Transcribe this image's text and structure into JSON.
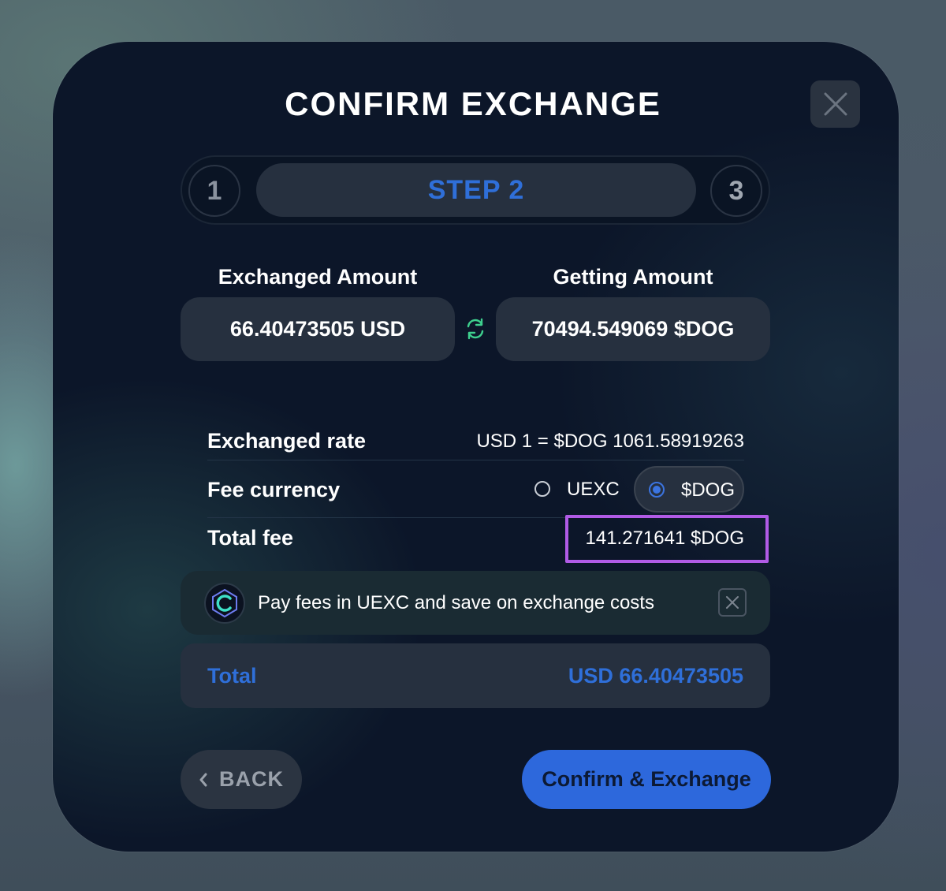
{
  "modal": {
    "title": "CONFIRM EXCHANGE",
    "close_icon": "close-icon"
  },
  "stepper": {
    "step1": "1",
    "step2": "STEP 2",
    "step3": "3",
    "current_step": 2
  },
  "amounts": {
    "exchanged_label": "Exchanged Amount",
    "exchanged_value": "66.40473505 USD",
    "getting_label": "Getting Amount",
    "getting_value": "70494.549069 $DOG",
    "swap_icon": "swap-arrows-icon"
  },
  "details": {
    "rate_label": "Exchanged rate",
    "rate_value": "USD 1 = $DOG 1061.58919263",
    "fee_currency_label": "Fee currency",
    "fee_options": [
      "UEXC",
      "$DOG"
    ],
    "fee_selected": "$DOG",
    "total_fee_label": "Total fee",
    "total_fee_value": "141.271641 $DOG"
  },
  "promo": {
    "text": "Pay fees in UEXC and save on exchange costs",
    "logo_icon": "uexc-logo-icon",
    "close_icon": "close-icon"
  },
  "total": {
    "label": "Total",
    "value": "USD 66.40473505"
  },
  "actions": {
    "back_label": "BACK",
    "confirm_label": "Confirm & Exchange"
  },
  "colors": {
    "accent": "#2d68dc",
    "highlight": "#b15be6",
    "panel": "#26303f",
    "background": "#0c1629"
  }
}
